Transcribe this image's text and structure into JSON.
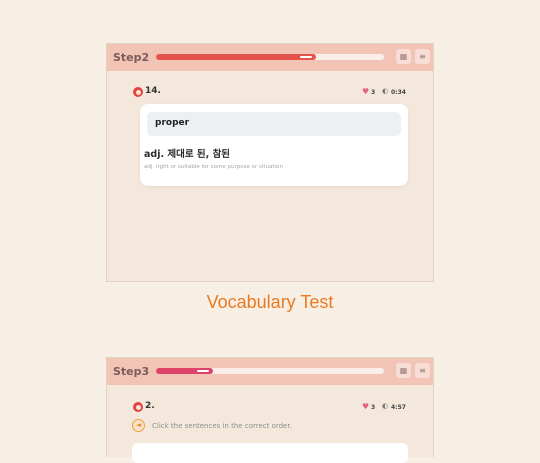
{
  "colors": {
    "page_bg": "#f8efe4",
    "panel_bg": "#f3e8db",
    "header_bg": "#f2c4b6",
    "progress_step2": "#e5544a",
    "progress_step3": "#de4268",
    "accent_title": "#ea7a22",
    "number_icon": "#e5433f"
  },
  "panel1": {
    "step_label": "Step2",
    "progress": 0.7,
    "header_icons": [
      "grid-icon",
      "list-icon"
    ],
    "question_number": "14.",
    "lives": "3",
    "timer": "0:34",
    "card": {
      "word": "proper",
      "meaning_ko": "adj. 제대로 된, 참된",
      "meaning_en": "adj. right or suitable for some purpose or situation"
    }
  },
  "section_title": "Vocabulary Test",
  "panel2": {
    "step_label": "Step3",
    "progress": 0.25,
    "header_icons": [
      "grid-icon",
      "list-icon"
    ],
    "question_number": "2.",
    "lives": "3",
    "timer": "4:57",
    "instruction": "Click the sentences in the correct order."
  }
}
